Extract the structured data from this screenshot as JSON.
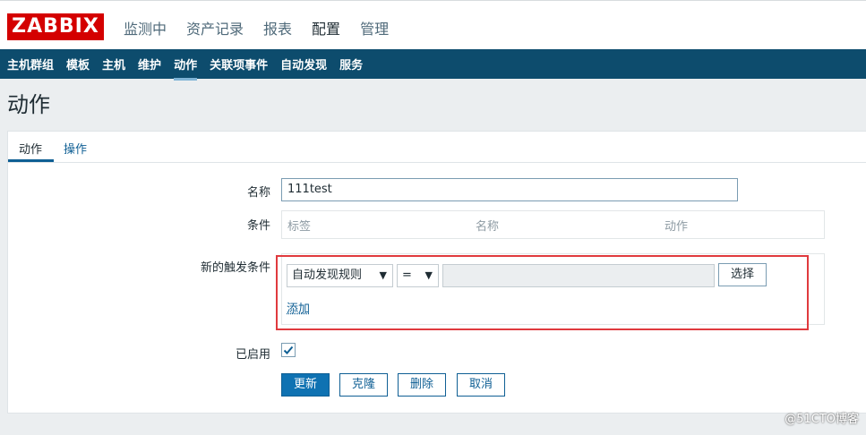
{
  "app": {
    "logo": "ZABBIX"
  },
  "topnav": [
    "监测中",
    "资产记录",
    "报表",
    "配置",
    "管理"
  ],
  "subnav": [
    "主机群组",
    "模板",
    "主机",
    "维护",
    "动作",
    "关联项事件",
    "自动发现",
    "服务"
  ],
  "page": {
    "title": "动作"
  },
  "tabs": [
    "动作",
    "操作"
  ],
  "form": {
    "name_label": "名称",
    "name_value": "111test",
    "conditions_label": "条件",
    "conditions_headers": [
      "标签",
      "名称",
      "动作"
    ],
    "new_condition_label": "新的触发条件",
    "condition_type": "自动发现规则",
    "condition_operator": "=",
    "select_button": "选择",
    "add_link": "添加",
    "enabled_label": "已启用",
    "enabled": true
  },
  "buttons": {
    "update": "更新",
    "clone": "克隆",
    "delete": "删除",
    "cancel": "取消"
  },
  "watermark": "@51CTO博客",
  "colors": {
    "brand": "#d40000",
    "nav": "#0d4c6d",
    "accent": "#0f72b2",
    "highlight": "#e03a3e"
  }
}
